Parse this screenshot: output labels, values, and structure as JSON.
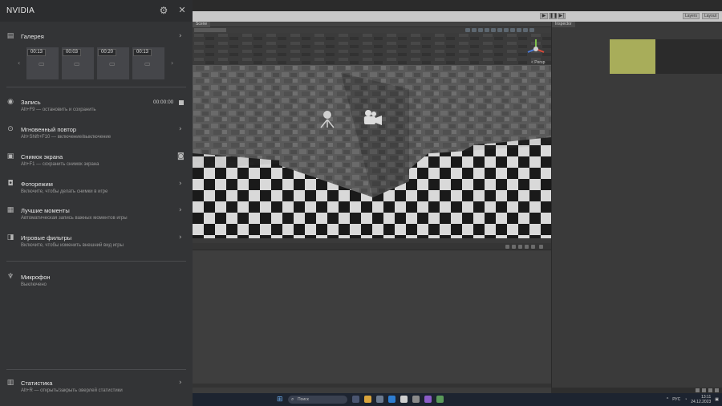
{
  "nvidia": {
    "title": "NVIDIA",
    "icons": {
      "settings": "gear-icon",
      "close": "close-icon"
    },
    "gallery": {
      "label": "Галерея",
      "thumbnails": [
        {
          "time": "00:13"
        },
        {
          "time": "00:03"
        },
        {
          "time": "00:20"
        },
        {
          "time": "00:13"
        }
      ]
    },
    "recording": {
      "label": "Запись",
      "hint": "Alt+F9 — остановить и сохранить",
      "timer": "00:00:00"
    },
    "instant_replay": {
      "label": "Мгновенный повтор",
      "hint": "Alt+Shift+F10 — включение/выключение"
    },
    "screenshot": {
      "label": "Снимок экрана",
      "hint": "Alt+F1 — сохранить снимок экрана"
    },
    "photo_mode": {
      "label": "Фоторежим",
      "hint": "Включите, чтобы делать снимки в игре"
    },
    "highlights": {
      "label": "Лучшие моменты",
      "hint": "Автоматическая запись важных моментов игры"
    },
    "game_filters": {
      "label": "Игровые фильтры",
      "hint": "Включите, чтобы изменить внешний вид игры"
    },
    "microphone": {
      "label": "Микрофон",
      "status": "Выключено"
    },
    "statistics": {
      "label": "Статистика",
      "hint": "Alt+R — открыть/закрыть оверлей статистики"
    }
  },
  "editor": {
    "play_controls": [
      "▶",
      "❚❚",
      "▶|"
    ],
    "top_right": [
      "Layers",
      "Layout"
    ],
    "scene_tab": "Scene",
    "inspector_tab": "Inspector",
    "gizmo_label": "< Persp",
    "accent_swatch": "#a8ad5a"
  },
  "taskbar": {
    "search_placeholder": "Поиск",
    "language": "РУС",
    "clock_time": "13:11",
    "clock_date": "24.12.2023"
  }
}
